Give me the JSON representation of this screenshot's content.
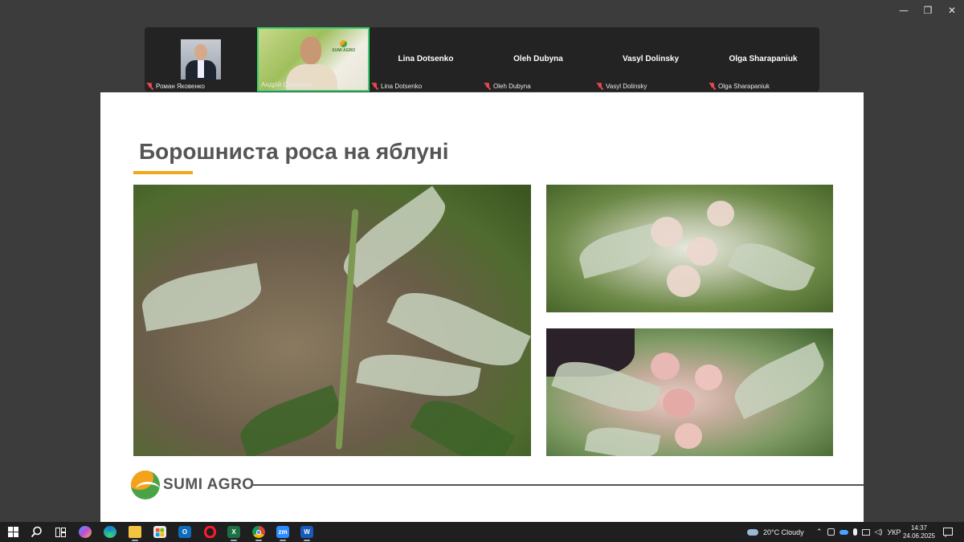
{
  "window": {
    "minimize_glyph": "—",
    "restore_glyph": "❐",
    "close_glyph": "✕"
  },
  "participants": [
    {
      "name": "Роман Яковенко",
      "display": ""
    },
    {
      "name": "Андрій Осиковий",
      "display": ""
    },
    {
      "name": "Lina Dotsenko",
      "display": "Lina Dotsenko"
    },
    {
      "name": "Oleh Dubyna",
      "display": "Oleh Dubyna"
    },
    {
      "name": "Vasyl Dolinsky",
      "display": "Vasyl Dolinsky"
    },
    {
      "name": "Olga Sharapaniuk",
      "display": "Olga Sharapaniuk"
    }
  ],
  "camera_logo_text": "SUMI AGRO",
  "slide": {
    "title": "Борошниста роса на яблуні",
    "logo_text": "SUMI AGRO"
  },
  "colors": {
    "accent": "#f2a818",
    "logo_green": "#4aa345",
    "logo_orange": "#f4a21b",
    "active_speaker": "#3bd16f"
  },
  "taskbar": {
    "icons": [
      "windows-start-icon",
      "search-icon",
      "task-view-icon",
      "copilot-icon",
      "edge-icon",
      "file-explorer-icon",
      "store-icon",
      "outlook-icon",
      "opera-icon",
      "excel-icon",
      "chrome-icon",
      "zoom-icon",
      "word-icon"
    ],
    "zoom_label": "zm",
    "excel_label": "X",
    "word_label": "W",
    "outlook_label": "O",
    "weather_text": "20°C  Cloudy",
    "language": "УКР",
    "time": "14:37",
    "date": "24.06.2025"
  }
}
